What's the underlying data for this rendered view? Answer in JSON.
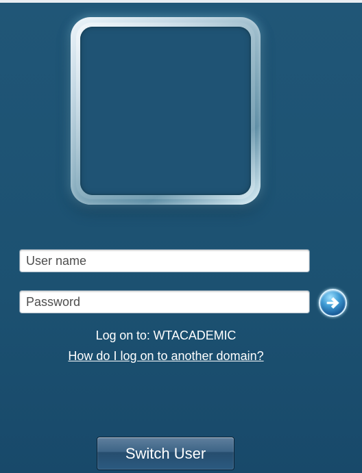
{
  "login": {
    "username_placeholder": "User name",
    "password_placeholder": "Password",
    "domain_text": "Log on to: WTACADEMIC",
    "domain_help_link": "How do I log on to another domain?",
    "switch_user_label": "Switch User"
  },
  "icons": {
    "submit": "arrow-right-icon"
  },
  "colors": {
    "background": "#1e5474",
    "text": "#ffffff",
    "button": "#2f5f86"
  }
}
